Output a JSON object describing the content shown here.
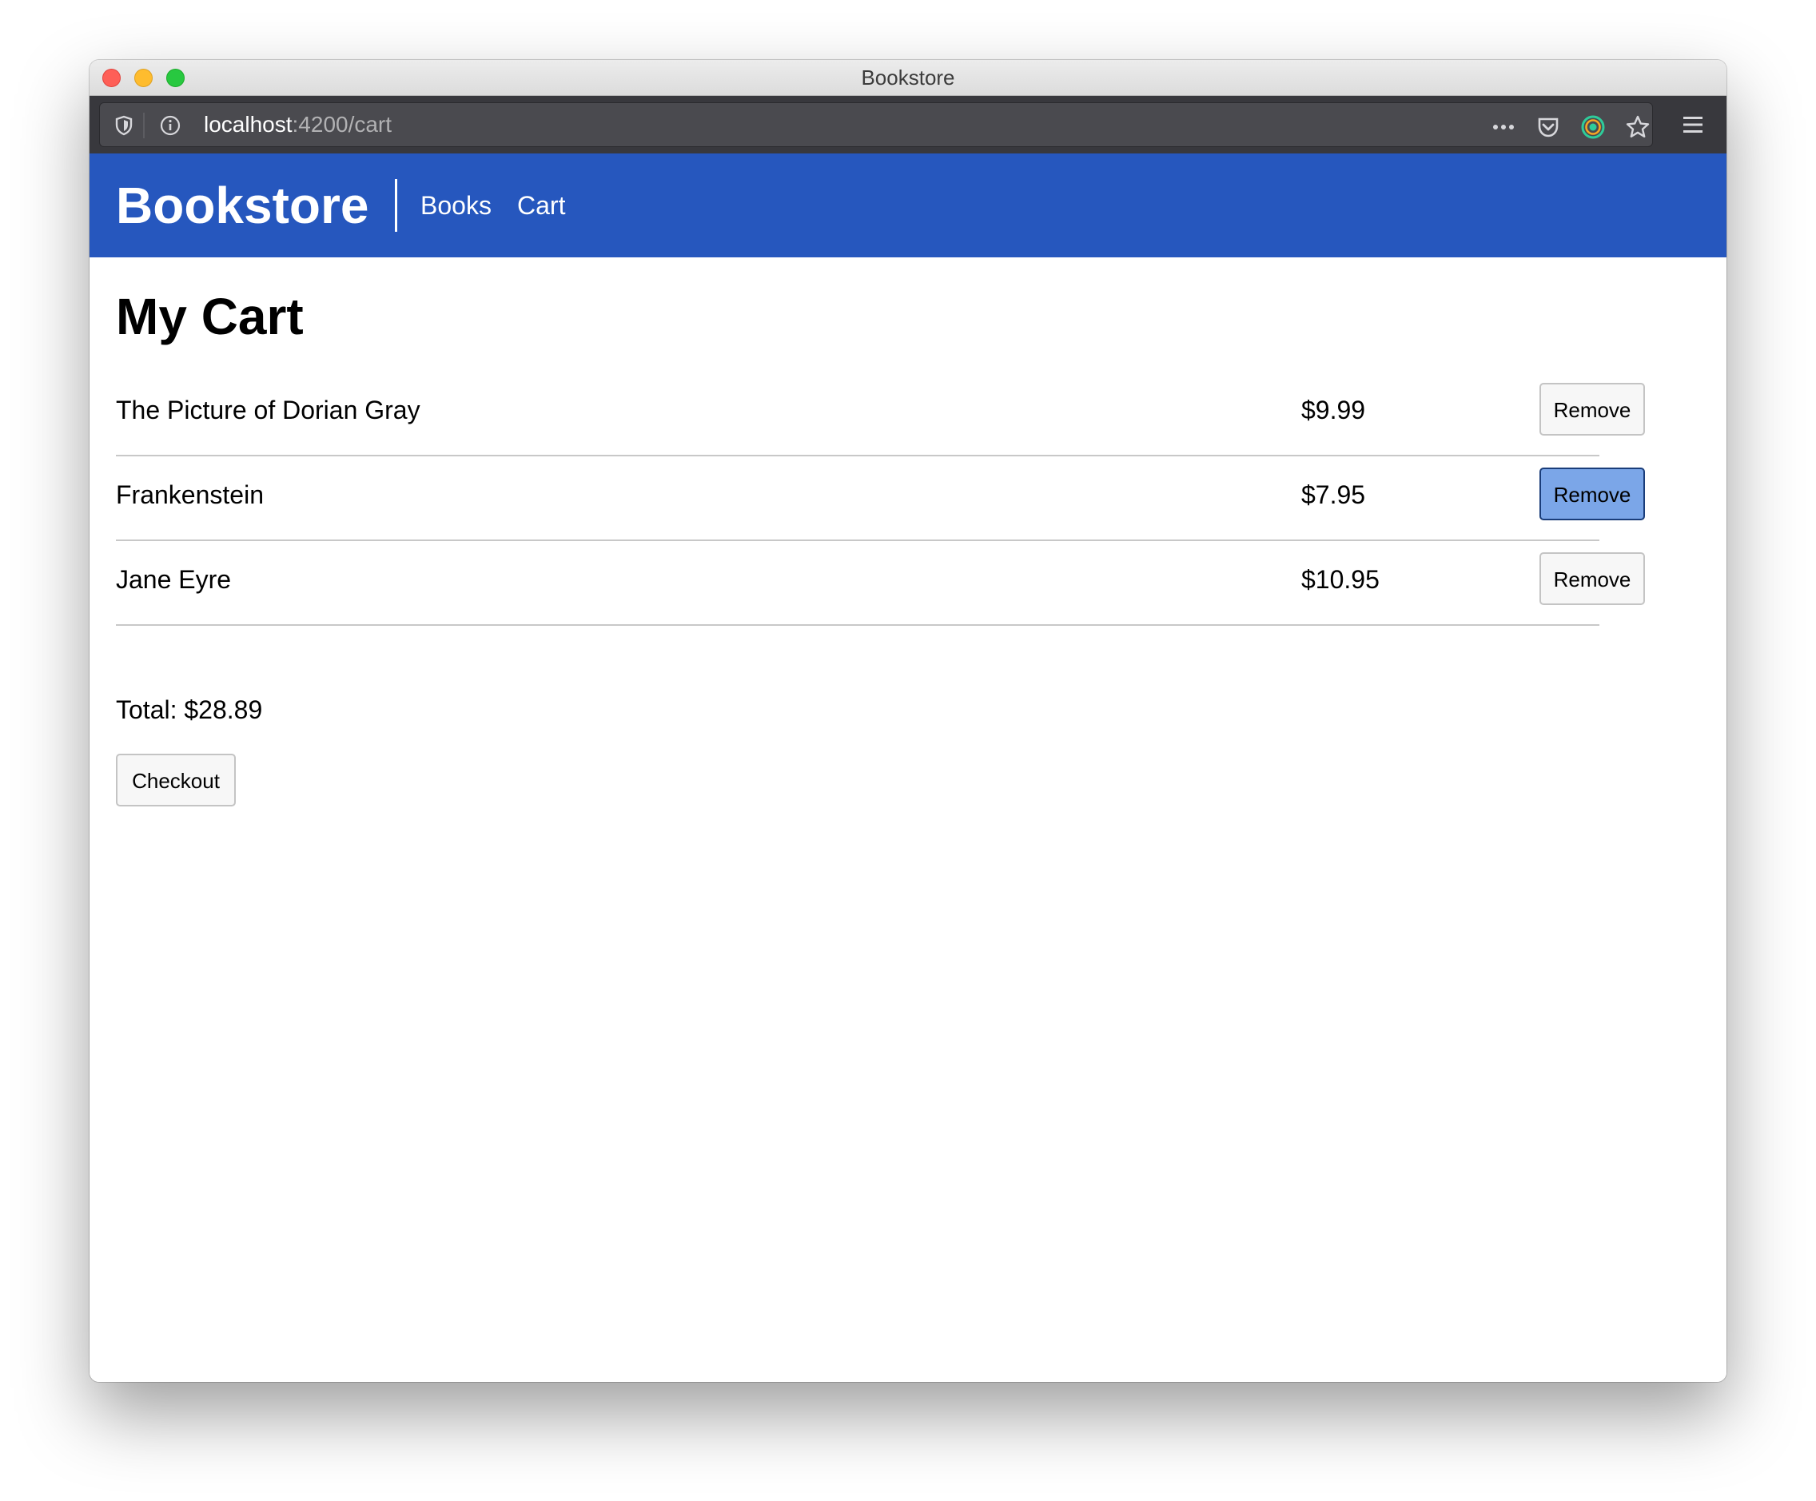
{
  "window": {
    "title": "Bookstore"
  },
  "browser": {
    "url_host": "localhost",
    "url_rest": ":4200/cart",
    "icons": [
      "shield-icon",
      "info-icon",
      "more-actions-icon",
      "pocket-icon",
      "extension-icon",
      "bookmark-star-icon",
      "hamburger-menu-icon"
    ]
  },
  "navbar": {
    "brand": "Bookstore",
    "links": [
      {
        "label": "Books"
      },
      {
        "label": "Cart"
      }
    ],
    "color": "#2657be"
  },
  "main": {
    "title": "My Cart",
    "items": [
      {
        "title": "The Picture of Dorian Gray",
        "price": "$9.99",
        "action": "Remove"
      },
      {
        "title": "Frankenstein",
        "price": "$7.95",
        "action": "Remove"
      },
      {
        "title": "Jane Eyre",
        "price": "$10.95",
        "action": "Remove"
      }
    ],
    "total": "Total: $28.89",
    "checkout_label": "Checkout"
  }
}
